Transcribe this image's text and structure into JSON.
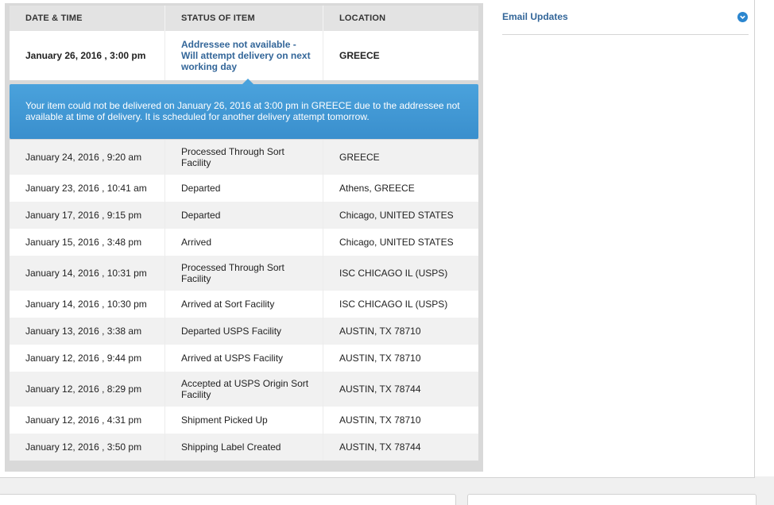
{
  "table": {
    "headers": [
      "DATE & TIME",
      "STATUS OF ITEM",
      "LOCATION"
    ],
    "latest": {
      "date": "January 26, 2016 , 3:00 pm",
      "status": "Addressee not available - Will attempt delivery on next working day",
      "location": "GREECE"
    },
    "banner_text": "Your item could not be delivered on January 26, 2016 at 3:00 pm in GREECE due to the addressee not available at time of delivery. It is scheduled for another delivery attempt tomorrow.",
    "rows": [
      {
        "date": "January 24, 2016 , 9:20 am",
        "status": "Processed Through Sort Facility",
        "location": "GREECE"
      },
      {
        "date": "January 23, 2016 , 10:41 am",
        "status": "Departed",
        "location": "Athens, GREECE"
      },
      {
        "date": "January 17, 2016 , 9:15 pm",
        "status": "Departed",
        "location": "Chicago, UNITED STATES"
      },
      {
        "date": "January 15, 2016 , 3:48 pm",
        "status": "Arrived",
        "location": "Chicago, UNITED STATES"
      },
      {
        "date": "January 14, 2016 , 10:31 pm",
        "status": "Processed Through Sort Facility",
        "location": "ISC CHICAGO IL (USPS)"
      },
      {
        "date": "January 14, 2016 , 10:30 pm",
        "status": "Arrived at Sort Facility",
        "location": "ISC CHICAGO IL (USPS)"
      },
      {
        "date": "January 13, 2016 , 3:38 am",
        "status": "Departed USPS Facility",
        "location": "AUSTIN, TX 78710"
      },
      {
        "date": "January 12, 2016 , 9:44 pm",
        "status": "Arrived at USPS Facility",
        "location": "AUSTIN, TX 78710"
      },
      {
        "date": "January 12, 2016 , 8:29 pm",
        "status": "Accepted at USPS Origin Sort Facility",
        "location": "AUSTIN, TX 78744"
      },
      {
        "date": "January 12, 2016 , 4:31 pm",
        "status": "Shipment Picked Up",
        "location": "AUSTIN, TX 78710"
      },
      {
        "date": "January 12, 2016 , 3:50 pm",
        "status": "Shipping Label Created",
        "location": "AUSTIN, TX 78744"
      }
    ]
  },
  "sidebar": {
    "email_updates_label": "Email Updates",
    "toggle_icon": "chevron-down-circle-icon"
  },
  "colors": {
    "link": "#336699",
    "banner": "#3a8fcd",
    "header_bg": "#e3e3e3"
  }
}
